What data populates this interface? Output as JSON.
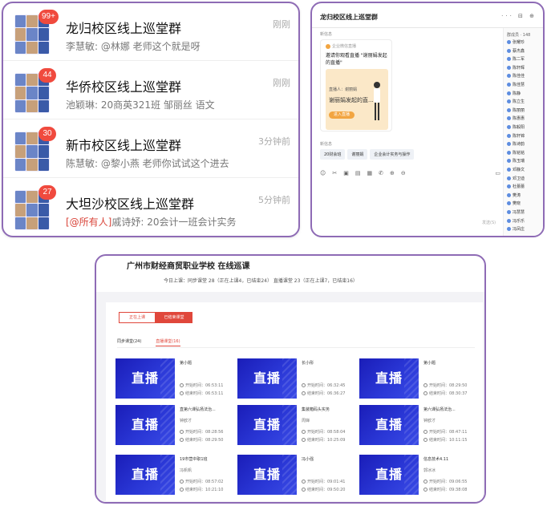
{
  "chat_list": [
    {
      "name": "龙归校区线上巡堂群",
      "badge": "99+",
      "time": "刚刚",
      "preview": "李慧敏: @林娜 老师这个就是呀",
      "at_all": ""
    },
    {
      "name": "华侨校区线上巡堂群",
      "badge": "44",
      "time": "刚刚",
      "preview": "池颖琳: 20商英321班 邹丽丝 语文",
      "at_all": ""
    },
    {
      "name": "新市校区线上巡堂群",
      "badge": "30",
      "time": "3分钟前",
      "preview": "陈慧敏: @黎小燕 老师你试试这个进去",
      "at_all": ""
    },
    {
      "name": "大坦沙校区线上巡堂群",
      "badge": "27",
      "time": "5分钟前",
      "preview": "戚诗妤: 20会计一班会计实务",
      "at_all": "[@所有人]"
    }
  ],
  "group_window": {
    "title": "龙归校区线上巡堂群",
    "icons": "··· ⊟ ⊕",
    "members_label": "群成员 · 148",
    "members": [
      "张耀珍",
      "蔡杰鑫",
      "陈二军",
      "陈轩辉",
      "陈佳佳",
      "陈佳慧",
      "陈静",
      "陈立生",
      "陈丽丽",
      "陈惠惠",
      "陈毅阳",
      "陈轩锦",
      "陈诗韵",
      "陈铭铭",
      "陈玉瑞",
      "邓静文",
      "邓卫迪",
      "杜蕾蕾",
      "樊涛",
      "樊晓",
      "冯慧慧",
      "冯乐乐",
      "冯凤庄"
    ],
    "sender1": "新信息",
    "card_head": "企业微信直播",
    "card_title": "邀请你观看直播 \"谢丽娟发起的直播\"",
    "card_host": "直播人：谢丽娟",
    "card_sub": "谢丽娟发起的直...",
    "card_btn": "进入直播",
    "sender2": "新信息",
    "tags": [
      "20财会班",
      "谢丽娟",
      "企业会计实务与操作"
    ],
    "toolbar": [
      "☺",
      "✂",
      "▣",
      "▤",
      "▦",
      "✆",
      "⊕",
      "⊖",
      "▭"
    ],
    "send_label": "发送(S)"
  },
  "school_panel": {
    "title": "广州市财经商贸职业学校 在线巡课",
    "stats": "今日上课：同步课堂 28（正在上课4，已结束24） 直播课堂 23（正在上课7，已结束16）",
    "filters": [
      "正在上课",
      "已结束课堂"
    ],
    "tabs": [
      "同步课堂(24)",
      "直播课堂(16)"
    ],
    "thumb_label": "直播",
    "courses": [
      {
        "title": "第小题",
        "teacher": "",
        "start": "开始时间：06:53:11",
        "end": "结束时间：06:53:11"
      },
      {
        "title": "长小彤",
        "teacher": "",
        "start": "开始时间：06:32:45",
        "end": "结束时间：06:36:27"
      },
      {
        "title": "第小题",
        "teacher": "",
        "start": "开始时间：08:29:50",
        "end": "结束时间：08:30:37"
      },
      {
        "title": "直第六课弘扬法治...",
        "teacher": "钟欧才",
        "start": "开始时间：08:28:56",
        "end": "结束时间：08:29:50"
      },
      {
        "title": "集装箱码头实务",
        "teacher": "周婵",
        "start": "开始时间：08:58:04",
        "end": "结束时间：10:25:09"
      },
      {
        "title": "第六课弘扬法治...",
        "teacher": "钟欧才",
        "start": "开始时间：08:47:11",
        "end": "结束时间：10:11:15"
      },
      {
        "title": "19市营中职1班",
        "teacher": "冯帆帆",
        "start": "开始时间：08:57:02",
        "end": "结束时间：10:21:10"
      },
      {
        "title": "冯小强",
        "teacher": "",
        "start": "开始时间：09:01:41",
        "end": "结束时间：09:50:20"
      },
      {
        "title": "信息技术4.11",
        "teacher": "郭冰冰",
        "start": "开始时间：09:06:55",
        "end": "结束时间：09:38:08"
      }
    ]
  },
  "colors": {
    "accent": "#e0473b",
    "border": "#8e6bb5",
    "badge": "#f04a3e",
    "thumb": "#1a1db8"
  }
}
